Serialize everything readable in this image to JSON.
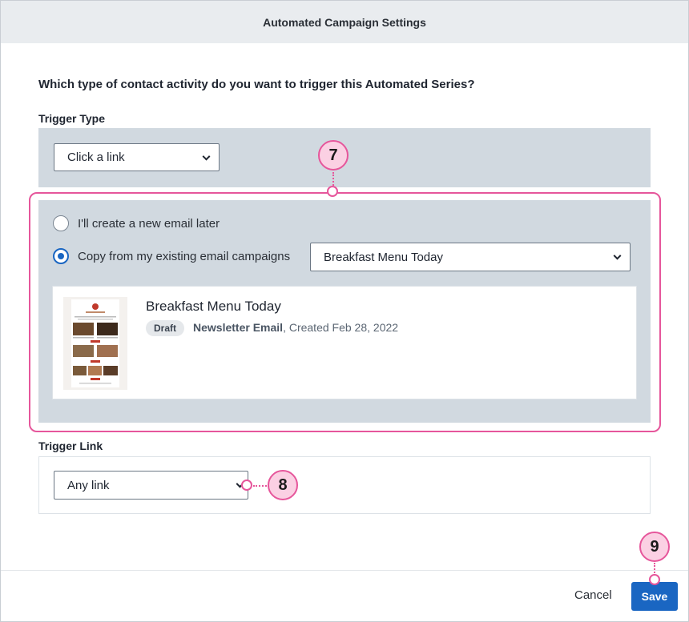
{
  "dialog": {
    "title": "Automated Campaign Settings"
  },
  "question": "Which type of contact activity do you want to trigger this Automated Series?",
  "trigger_type": {
    "label": "Trigger Type",
    "selected": "Click a link"
  },
  "email_source": {
    "option_new": "I'll create a new email later",
    "option_copy": "Copy from my existing email campaigns",
    "selected_option": "copy",
    "campaign_select": "Breakfast Menu Today"
  },
  "campaign_card": {
    "title": "Breakfast Menu Today",
    "status": "Draft",
    "type": "Newsletter Email",
    "created": ", Created Feb 28, 2022"
  },
  "trigger_link": {
    "label": "Trigger Link",
    "selected": "Any link"
  },
  "callouts": {
    "c7": "7",
    "c8": "8",
    "c9": "9"
  },
  "footer": {
    "cancel_label": "Cancel",
    "save_label": "Save"
  },
  "colors": {
    "accent": "#1a66c2",
    "callout": "#e6569b",
    "panel": "#d1d9e0"
  }
}
